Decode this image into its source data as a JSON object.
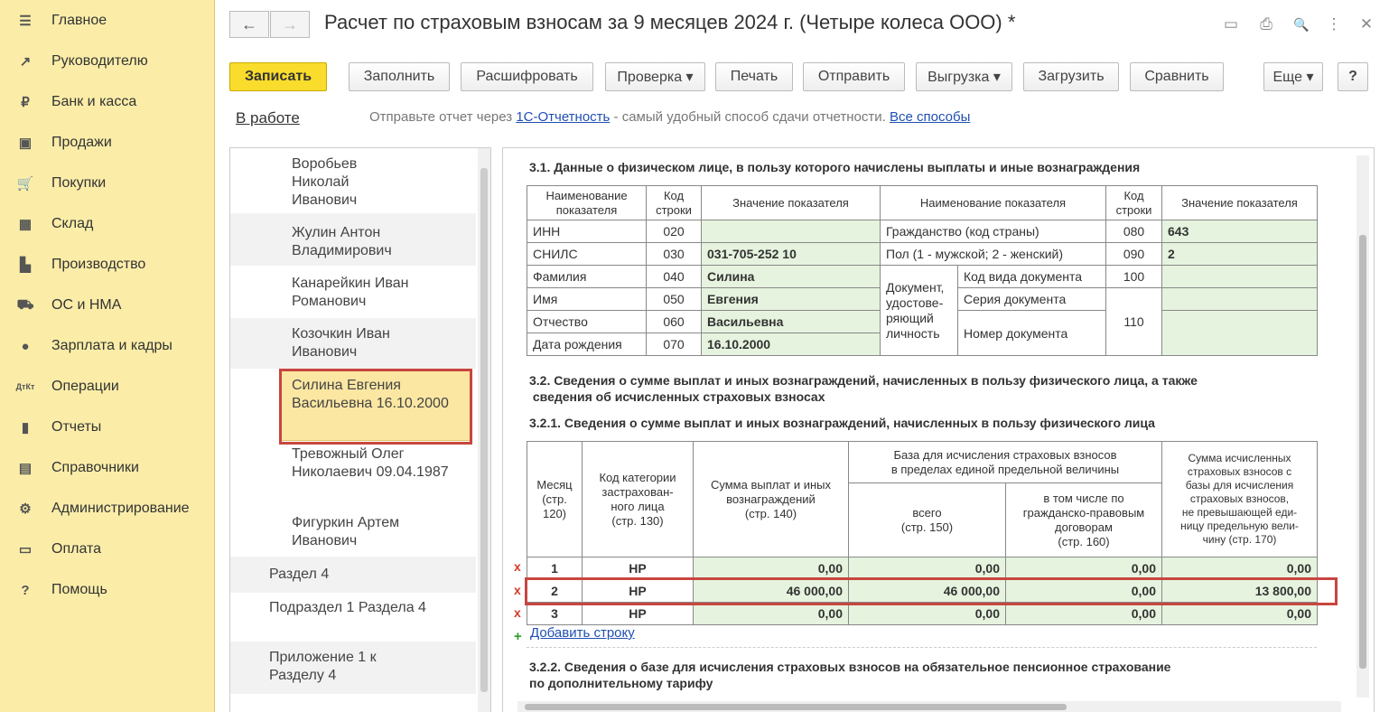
{
  "sidebar": {
    "items": [
      {
        "icon": "menu-icon",
        "glyph": "☰",
        "label": "Главное"
      },
      {
        "icon": "trend-icon",
        "glyph": "↗",
        "label": "Руководителю"
      },
      {
        "icon": "ruble-icon",
        "glyph": "₽",
        "label": "Банк и касса"
      },
      {
        "icon": "bag-icon",
        "glyph": "▣",
        "label": "Продажи"
      },
      {
        "icon": "cart-icon",
        "glyph": "🛒",
        "label": "Покупки"
      },
      {
        "icon": "warehouse-icon",
        "glyph": "▦",
        "label": "Склад"
      },
      {
        "icon": "factory-icon",
        "glyph": "▙",
        "label": "Производство"
      },
      {
        "icon": "truck-icon",
        "glyph": "⛟",
        "label": "ОС и НМА"
      },
      {
        "icon": "person-icon",
        "glyph": "●",
        "label": "Зарплата и кадры"
      },
      {
        "icon": "operations-icon",
        "glyph": "ДтКт",
        "label": "Операции"
      },
      {
        "icon": "bar-chart-icon",
        "glyph": "▮",
        "label": "Отчеты"
      },
      {
        "icon": "books-icon",
        "glyph": "▤",
        "label": "Справочники"
      },
      {
        "icon": "gear-icon",
        "glyph": "⚙",
        "label": "Администрирование"
      },
      {
        "icon": "payment-icon",
        "glyph": "▭",
        "label": "Оплата"
      },
      {
        "icon": "help-icon",
        "glyph": "?",
        "label": "Помощь"
      }
    ]
  },
  "header": {
    "title": "Расчет по страховым взносам за 9 месяцев 2024 г. (Четыре колеса ООО) *",
    "back": "←",
    "forward": "→",
    "icons": {
      "save": "▭",
      "print": "⎙",
      "preview": "🔍",
      "more": "⋮",
      "close": "✕"
    }
  },
  "toolbar": {
    "write": "Записать",
    "fill": "Заполнить",
    "decode": "Расшифровать",
    "check": "Проверка ▾",
    "print": "Печать",
    "send": "Отправить",
    "export": "Выгрузка ▾",
    "load": "Загрузить",
    "compare": "Сравнить",
    "more": "Еще ▾",
    "help": "?"
  },
  "status": {
    "state": "В работе",
    "text_before": "Отправьте отчет через ",
    "link1": "1С-Отчетность",
    "text_after": " - самый удобный способ сдачи отчетности. ",
    "link2": "Все способы"
  },
  "tree": [
    {
      "label": "Воробьев\nНиколай\nИванович"
    },
    {
      "label": "Жулин Антон\nВладимирович"
    },
    {
      "label": "Канарейкин Иван\nРоманович"
    },
    {
      "label": "Козочкин Иван\nИванович"
    },
    {
      "label": "Силина Евгения\nВасильевна 16.10.2000"
    },
    {
      "label": "Тревожный Олег\nНиколаевич 09.04.1987"
    },
    {
      "label": "Фигуркин Артем\nИванович"
    },
    {
      "label": "Раздел 4"
    },
    {
      "label": "Подраздел 1 Раздела 4"
    },
    {
      "label": "Приложение 1 к\nРазделу 4"
    }
  ],
  "section31": {
    "title": "3.1. Данные о физическом лице, в пользу которого начислены выплаты и иные вознаграждения",
    "h_name": "Наименование\nпоказателя",
    "h_code": "Код\nстроки",
    "h_value": "Значение показателя",
    "h_name2": "Наименование показателя",
    "h_code2": "Код\nстроки",
    "h_value2": "Значение показателя",
    "rows": [
      {
        "name": "ИНН",
        "code": "020",
        "value": ""
      },
      {
        "name": "СНИЛС",
        "code": "030",
        "value": "031-705-252 10"
      },
      {
        "name": "Фамилия",
        "code": "040",
        "value": "Силина"
      },
      {
        "name": "Имя",
        "code": "050",
        "value": "Евгения"
      },
      {
        "name": "Отчество",
        "code": "060",
        "value": "Васильевна"
      },
      {
        "name": "Дата рождения",
        "code": "070",
        "value": "16.10.2000"
      }
    ],
    "right": {
      "citizenship": "Гражданство (код страны)",
      "citizenship_code": "080",
      "citizenship_value": "643",
      "sex": "Пол (1 - мужской; 2 - женский)",
      "sex_code": "090",
      "sex_value": "2",
      "doc_group": "Документ,\nудостове-\nряющий\nличность",
      "doc_type": "Код вида документа",
      "doc_type_code": "100",
      "doc_series": "Серия документа",
      "doc_number": "Номер документа",
      "doc_code": "110"
    }
  },
  "section32": {
    "title": "3.2. Сведения о сумме выплат и иных вознаграждений, начисленных в пользу физического лица, а также\n сведения об исчисленных страховых взносах"
  },
  "section321": {
    "title": "3.2.1. Сведения о сумме выплат и иных вознаграждений, начисленных в пользу физического лица",
    "h_month": "Месяц\n(стр.\n120)",
    "h_cat": "Код категории\nзастрахован-\nного лица\n(стр. 130)",
    "h_sum": "Сумма выплат и иных\nвознаграждений\n(стр. 140)",
    "h_base": "База для исчисления страховых взносов\nв пределах единой предельной величины",
    "h_total": "всего\n(стр. 150)",
    "h_gpd": "в том числе по\nгражданско-правовым\nдоговорам\n(стр. 160)",
    "h_contrib": "Сумма исчисленных\nстраховых взносов с\nбазы для исчисления\nстраховых взносов,\nне превышающей еди-\nницу предельную вели-\nчину (стр. 170)",
    "rows": [
      {
        "mark": "x",
        "month": "1",
        "cat": "НР",
        "sum": "0,00",
        "total": "0,00",
        "gpd": "0,00",
        "contrib": "0,00"
      },
      {
        "mark": "x",
        "month": "2",
        "cat": "НР",
        "sum": "46 000,00",
        "total": "46 000,00",
        "gpd": "0,00",
        "contrib": "13 800,00"
      },
      {
        "mark": "x",
        "month": "3",
        "cat": "НР",
        "sum": "0,00",
        "total": "0,00",
        "gpd": "0,00",
        "contrib": "0,00"
      }
    ],
    "add_row": "Добавить строку",
    "add_icon": "+"
  },
  "section322": {
    "title": "3.2.2. Сведения о базе для исчисления страховых взносов на обязательное пенсионное страхование\nпо дополнительному тарифу"
  },
  "colors": {
    "sidebar": "#fbeda8",
    "accent": "#fadc2c",
    "highlight": "#c8463f",
    "value_bg": "#e6f3de",
    "link": "#1f4fb2"
  }
}
